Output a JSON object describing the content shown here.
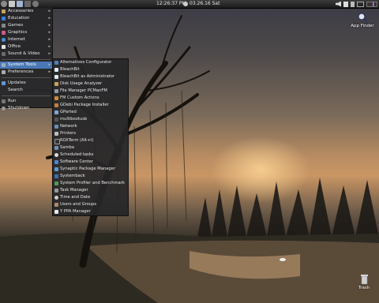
{
  "panel": {
    "time": "12:26:37 PM",
    "date": "03.26.16 Sat"
  },
  "desktop": {
    "app_finder_label": "App Finder",
    "trash_label": "Trash"
  },
  "menu": {
    "items": [
      {
        "label": "Accessories"
      },
      {
        "label": "Education"
      },
      {
        "label": "Games"
      },
      {
        "label": "Graphics"
      },
      {
        "label": "Internet"
      },
      {
        "label": "Office"
      },
      {
        "label": "Sound & Video"
      },
      {
        "label": "System Tools"
      },
      {
        "label": "Preferences"
      },
      {
        "label": "Updates"
      },
      {
        "label": "Search"
      },
      {
        "label": "Run"
      },
      {
        "label": "Shutdown"
      }
    ]
  },
  "submenu": {
    "items": [
      {
        "label": "Alternatives Configurator"
      },
      {
        "label": "BleachBit"
      },
      {
        "label": "BleachBit as Administrator"
      },
      {
        "label": "Disk Usage Analyzer"
      },
      {
        "label": "File Manager PCManFM"
      },
      {
        "label": "FM Custom Actions"
      },
      {
        "label": "GDebi Package Installer"
      },
      {
        "label": "GParted"
      },
      {
        "label": "multibootusb"
      },
      {
        "label": "Network"
      },
      {
        "label": "Printers"
      },
      {
        "label": "ROXTerm (Alt+t)"
      },
      {
        "label": "Samba"
      },
      {
        "label": "Scheduled tasks"
      },
      {
        "label": "Software Center"
      },
      {
        "label": "Synaptic Package Manager"
      },
      {
        "label": "Systemback"
      },
      {
        "label": "System Profiler and Benchmark"
      },
      {
        "label": "Task Manager"
      },
      {
        "label": "Time and Date"
      },
      {
        "label": "Users and Groups"
      },
      {
        "label": "Y PPA Manager"
      }
    ]
  },
  "colors": {
    "menu_highlight": "#4a77b5",
    "menu_background": "#262628",
    "panel_background": "#1b1b1b"
  }
}
